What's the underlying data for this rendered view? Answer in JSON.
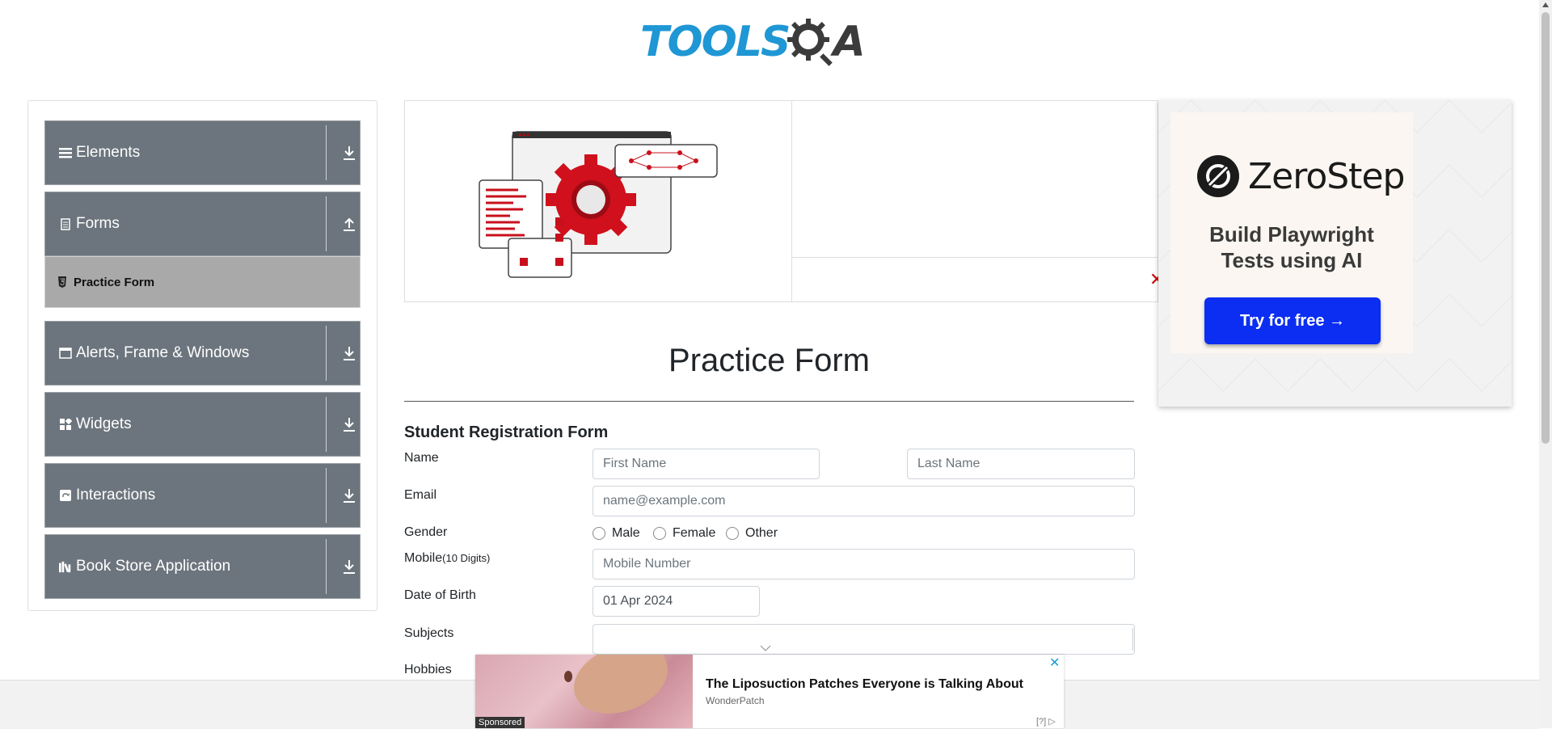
{
  "logo": {
    "part1": "TOOLS",
    "part2": "A"
  },
  "sidebar": {
    "groups": [
      {
        "label": "Elements",
        "icon": "hamburger-icon",
        "expanded": false
      },
      {
        "label": "Forms",
        "icon": "document-icon",
        "expanded": true
      },
      {
        "label": "Alerts, Frame & Windows",
        "icon": "window-icon",
        "expanded": false
      },
      {
        "label": "Widgets",
        "icon": "widgets-icon",
        "expanded": false
      },
      {
        "label": "Interactions",
        "icon": "interactions-icon",
        "expanded": false
      },
      {
        "label": "Book Store Application",
        "icon": "books-icon",
        "expanded": false
      }
    ],
    "active_item": {
      "label": "Practice Form",
      "icon": "html5-icon"
    }
  },
  "ad_right": {
    "brand": "ZeroStep",
    "headline_line1": "Build Playwright",
    "headline_line2": "Tests using AI",
    "cta": "Try for free →"
  },
  "page": {
    "title": "Practice Form"
  },
  "form": {
    "title": "Student Registration Form",
    "name_label": "Name",
    "first_name_placeholder": "First Name",
    "last_name_placeholder": "Last Name",
    "email_label": "Email",
    "email_placeholder": "name@example.com",
    "gender_label": "Gender",
    "gender_options": [
      "Male",
      "Female",
      "Other"
    ],
    "mobile_label": "Mobile",
    "mobile_hint": "(10 Digits)",
    "mobile_placeholder": "Mobile Number",
    "dob_label": "Date of Birth",
    "dob_value": "01 Apr 2024",
    "subjects_label": "Subjects",
    "hobbies_label": "Hobbies"
  },
  "ad_bottom": {
    "headline": "The Liposuction Patches Everyone is Talking About",
    "brand": "WonderPatch",
    "sponsored": "Sponsored",
    "info": "[?]",
    "close": "✕"
  },
  "colors": {
    "nav_bg": "#6c757d",
    "active_bg": "#a9a9a9",
    "logo_blue": "#1f97d4",
    "cta_blue": "#0b2ef2"
  }
}
